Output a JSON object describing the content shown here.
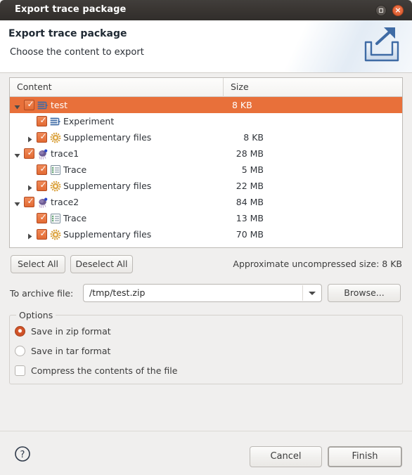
{
  "window": {
    "title": "Export trace package",
    "maximize_icon": "maximize-icon",
    "close_icon": "close-icon",
    "close_glyph": "×"
  },
  "banner": {
    "title": "Export trace package",
    "subtitle": "Choose the content to export",
    "icon": "export-trace-icon"
  },
  "tree": {
    "columns": [
      "Content",
      "Size"
    ],
    "rows": [
      {
        "label": "test",
        "size": "8 KB",
        "indent": 0,
        "twisty": "expanded",
        "checked": true,
        "icon": "experiment-icon",
        "selected": true
      },
      {
        "label": "Experiment",
        "size": "",
        "indent": 1,
        "twisty": "none",
        "checked": true,
        "icon": "experiment-icon",
        "selected": false
      },
      {
        "label": "Supplementary files",
        "size": "8 KB",
        "indent": 1,
        "twisty": "collapsed",
        "checked": true,
        "icon": "gear-icon",
        "selected": false
      },
      {
        "label": "trace1",
        "size": "28 MB",
        "indent": 0,
        "twisty": "expanded",
        "checked": true,
        "icon": "trace-icon",
        "selected": false
      },
      {
        "label": "Trace",
        "size": "5 MB",
        "indent": 1,
        "twisty": "none",
        "checked": true,
        "icon": "trace-list-icon",
        "selected": false
      },
      {
        "label": "Supplementary files",
        "size": "22 MB",
        "indent": 1,
        "twisty": "collapsed",
        "checked": true,
        "icon": "gear-icon",
        "selected": false
      },
      {
        "label": "trace2",
        "size": "84 MB",
        "indent": 0,
        "twisty": "expanded",
        "checked": true,
        "icon": "trace-icon",
        "selected": false
      },
      {
        "label": "Trace",
        "size": "13 MB",
        "indent": 1,
        "twisty": "none",
        "checked": true,
        "icon": "trace-list-icon",
        "selected": false
      },
      {
        "label": "Supplementary files",
        "size": "70 MB",
        "indent": 1,
        "twisty": "collapsed",
        "checked": true,
        "icon": "gear-icon",
        "selected": false
      }
    ]
  },
  "actions": {
    "select_all": "Select All",
    "deselect_all": "Deselect All",
    "approximate_size": "Approximate uncompressed size: 8 KB"
  },
  "archive": {
    "label": "To archive file:",
    "value": "/tmp/test.zip",
    "placeholder": "",
    "dropdown_icon": "chevron-down-icon",
    "browse": "Browse..."
  },
  "options": {
    "title": "Options",
    "items": [
      {
        "label": "Save in zip format",
        "type": "radio",
        "checked": true
      },
      {
        "label": "Save in tar format",
        "type": "radio",
        "checked": false
      },
      {
        "label": "Compress the contents of the file",
        "type": "checkbox",
        "checked": false
      }
    ]
  },
  "footer": {
    "help_icon": "help-icon",
    "cancel": "Cancel",
    "finish": "Finish"
  },
  "colors": {
    "accent": "#e8703a",
    "checkbox_fill": "#e26a33",
    "titlebar": "#393532",
    "close_button": "#e4663a",
    "dialog_bg": "#f0efee"
  }
}
